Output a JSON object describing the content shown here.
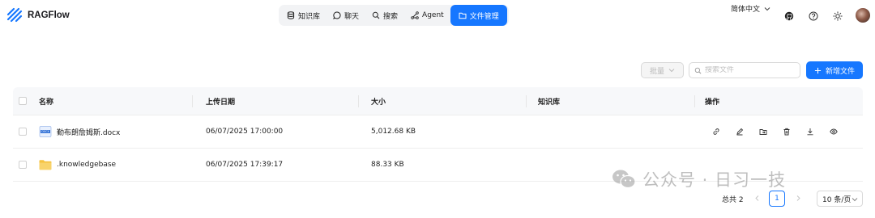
{
  "app": {
    "name": "RAGFlow"
  },
  "nav": {
    "items": [
      {
        "label": "知识库",
        "icon": "database-icon",
        "active": false
      },
      {
        "label": "聊天",
        "icon": "chat-bubble-icon",
        "active": false
      },
      {
        "label": "搜索",
        "icon": "search-icon",
        "active": false
      },
      {
        "label": "Agent",
        "icon": "agent-icon",
        "active": false
      },
      {
        "label": "文件管理",
        "icon": "folder-icon",
        "active": true
      }
    ]
  },
  "header_right": {
    "language": "简体中文",
    "icons": [
      "github-icon",
      "help-icon",
      "theme-sun-icon"
    ],
    "avatar": "user-avatar"
  },
  "toolbar": {
    "batch_label": "批量",
    "search_placeholder": "搜索文件",
    "search_value": "",
    "add_label": "新增文件"
  },
  "table": {
    "columns": [
      "名称",
      "上传日期",
      "大小",
      "知识库",
      "操作"
    ],
    "rows": [
      {
        "name": "勤布朗詹姆斯.docx",
        "type": "docx",
        "date": "06/07/2025 17:00:00",
        "size": "5,012.68 KB",
        "kb": "",
        "has_actions": true
      },
      {
        "name": ".knowledgebase",
        "type": "folder",
        "date": "06/07/2025 17:39:17",
        "size": "88.33 KB",
        "kb": "",
        "has_actions": false
      }
    ],
    "row_action_icons": [
      "link-icon",
      "edit-icon",
      "move-to-folder-icon",
      "delete-icon",
      "download-icon",
      "preview-eye-icon"
    ]
  },
  "pagination": {
    "total_label": "总共 2",
    "current_page": "1",
    "page_size_label": "10 条/页"
  },
  "watermark": {
    "text": "公众号 · 日习一技"
  },
  "colors": {
    "accent": "#1677ff",
    "nav_bg": "#f2f3f5",
    "header_row_bg": "#f7f8fa",
    "folder": "#f5c342",
    "docx": "#2f6fd6"
  }
}
